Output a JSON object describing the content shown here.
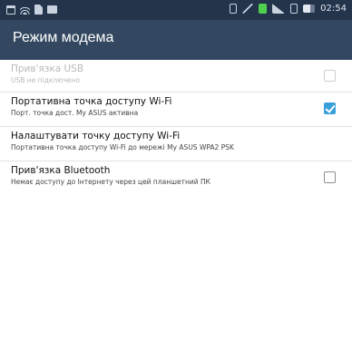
{
  "status_bar": {
    "time": "02:54",
    "left_icons": [
      "calendar-icon",
      "wifi-icon",
      "file-icon",
      "message-icon"
    ],
    "right_icons": [
      "vibrate-icon",
      "mute-icon",
      "green-app-icon",
      "signal-icon",
      "sim-icon",
      "data-icon",
      "battery-icon"
    ]
  },
  "app_bar": {
    "title": "Режим модема"
  },
  "settings": {
    "items": [
      {
        "title": "Прив'язка USB",
        "subtitle": "USB не підключено",
        "enabled": false,
        "checked": false,
        "has_checkbox": true
      },
      {
        "title": "Портативна точка доступу Wi-Fi",
        "subtitle": "Порт. точка дост. My ASUS активна",
        "enabled": true,
        "checked": true,
        "has_checkbox": true
      },
      {
        "title": "Налаштувати точку доступу Wi-Fi",
        "subtitle": "Портативна точка доступу Wi-Fi до мережі My ASUS WPA2 PSK",
        "enabled": true,
        "checked": false,
        "has_checkbox": false
      },
      {
        "title": "Прив'язка Bluetooth",
        "subtitle": "Немає доступу до Інтернету через цей планшетний ПК",
        "enabled": true,
        "checked": false,
        "has_checkbox": true
      }
    ]
  },
  "colors": {
    "status_bar": "#24344b",
    "app_bar": "#334860",
    "accent_checkbox": "#3aa0dc"
  }
}
